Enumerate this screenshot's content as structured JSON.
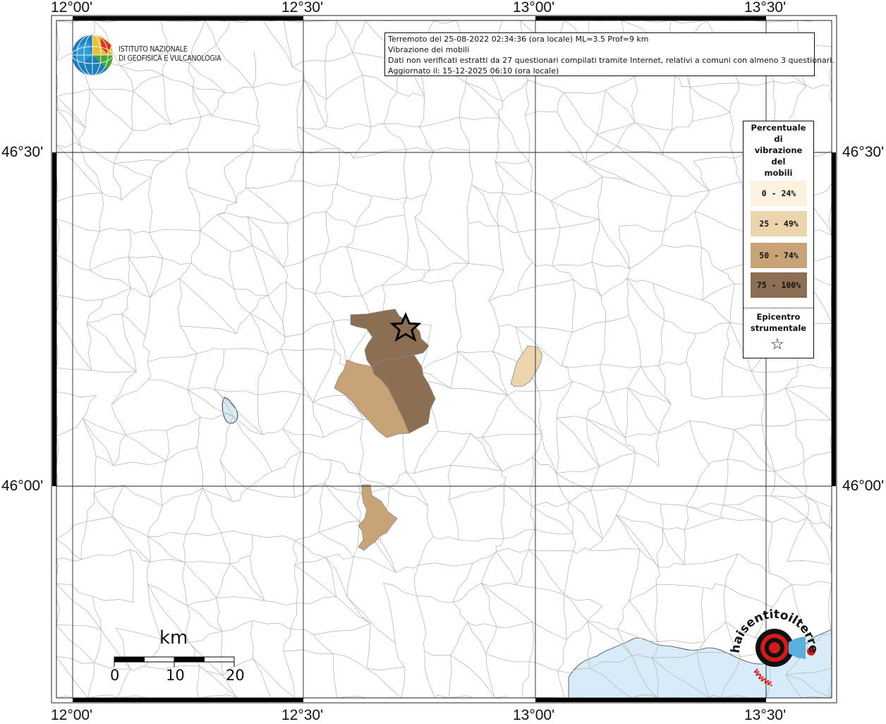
{
  "map": {
    "longitude_labels": [
      "12°00'",
      "12°30'",
      "13°00'",
      "13°30'"
    ],
    "latitude_labels": [
      "46°30'",
      "46°00'"
    ],
    "colors": {
      "background": "#ffffff",
      "boundaries": "#b9b9b9",
      "graticule": "#222222",
      "water": "#d7ebf8",
      "class_0_24": "#fdf1df",
      "class_25_49": "#ecd5ac",
      "class_50_74": "#c8a378",
      "class_75_100": "#8c6f52"
    }
  },
  "institute": {
    "line1": "ISTITUTO NAZIONALE",
    "line2": "DI GEOFISICA E VULCANOLOGIA"
  },
  "info": {
    "line1": "Terremoto del 25-08-2022 02:34:36 (ora locale) ML=3.5 Prof=9 km",
    "line2": "Vibrazione dei mobili",
    "line3": "Dati non verificati estratti da 27 questionari compilati tramite Internet, relativi a comuni con almeno 3 questionari.",
    "line4": "Aggiornato il: 15-12-2025 06:10 (ora locale)"
  },
  "legend": {
    "title_lines": [
      "Percentuale",
      "di",
      "vibrazione",
      "del",
      "mobili"
    ],
    "items": [
      {
        "label": "0 - 24%",
        "color": "#fdf1df"
      },
      {
        "label": "25 - 49%",
        "color": "#ecd5ac"
      },
      {
        "label": "50 - 74%",
        "color": "#c8a378"
      },
      {
        "label": "75 - 100%",
        "color": "#8c6f52"
      }
    ],
    "epicenter_lines": [
      "Epicentro",
      "strumentale"
    ],
    "epicenter_symbol": "☆"
  },
  "scale": {
    "unit": "km",
    "ticks": [
      "0",
      "10",
      "20"
    ]
  },
  "badge": {
    "text_top": "haisentitoilterremoto.it",
    "text_bottom": "www."
  }
}
